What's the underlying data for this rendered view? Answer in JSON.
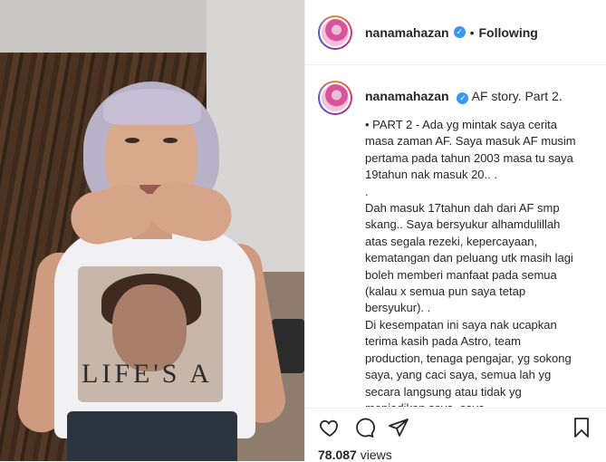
{
  "post": {
    "username": "nanamahazan",
    "follow_state": "Following",
    "separator": "•",
    "verified_glyph": "✓"
  },
  "media": {
    "shirt_text": "LIFE'S A"
  },
  "caption": {
    "title": "AF story. Part 2.",
    "body": "• PART 2 - Ada yg mintak saya cerita masa zaman AF. Saya masuk AF musim pertama pada tahun 2003 masa tu saya 19tahun nak masuk 20.. .\n.\nDah masuk 17tahun dah dari AF smp skang.. Saya bersyukur alhamdulillah atas segala rezeki, kepercayaan, kematangan dan peluang utk masih lagi boleh memberi manfaat pada semua (kalau x semua pun saya tetap bersyukur). .\nDi kesempatan ini saya nak ucapkan terima kasih pada Astro, team production, tenaga pengajar, yg sokong saya, yang caci saya, semua lah yg secara langsung atau tidak yg menjadikan saya, saya."
  },
  "stats": {
    "views_count": "78.087",
    "views_label": "views"
  },
  "icons": {
    "like": "heart-icon",
    "comment": "comment-icon",
    "share": "share-icon",
    "save": "bookmark-icon",
    "verified": "verified-badge-icon"
  },
  "colors": {
    "verified_blue": "#3897f0",
    "divider": "#efefef",
    "text": "#262626"
  }
}
